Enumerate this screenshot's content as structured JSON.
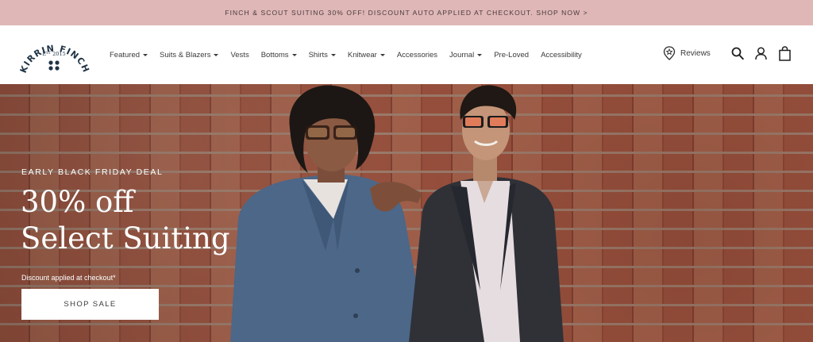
{
  "announcement": {
    "text": "FINCH & SCOUT SUITING 30% OFF! DISCOUNT AUTO APPLIED AT CHECKOUT. SHOP NOW >"
  },
  "logo": {
    "brand": "KIRRIN FINCH",
    "established": "EST 2015"
  },
  "nav": {
    "items": [
      {
        "label": "Featured",
        "dropdown": true
      },
      {
        "label": "Suits & Blazers",
        "dropdown": true
      },
      {
        "label": "Vests",
        "dropdown": false
      },
      {
        "label": "Bottoms",
        "dropdown": true
      },
      {
        "label": "Shirts",
        "dropdown": true
      },
      {
        "label": "Knitwear",
        "dropdown": true
      },
      {
        "label": "Accessories",
        "dropdown": false
      },
      {
        "label": "Journal",
        "dropdown": true
      },
      {
        "label": "Pre-Loved",
        "dropdown": false
      },
      {
        "label": "Accessibility",
        "dropdown": false
      }
    ]
  },
  "header_actions": {
    "reviews_label": "Reviews",
    "icons": [
      "reviews-badge-icon",
      "search-icon",
      "account-icon",
      "cart-icon"
    ]
  },
  "hero": {
    "eyebrow": "EARLY BLACK FRIDAY DEAL",
    "headline_line1": "30% off",
    "headline_line2": "Select Suiting",
    "disclaimer": "Discount applied at checkout*",
    "cta_label": "SHOP SALE"
  },
  "colors": {
    "announcement_bg": "#dfb7b7",
    "logo_navy": "#1f3345",
    "brick": "#98503d"
  }
}
